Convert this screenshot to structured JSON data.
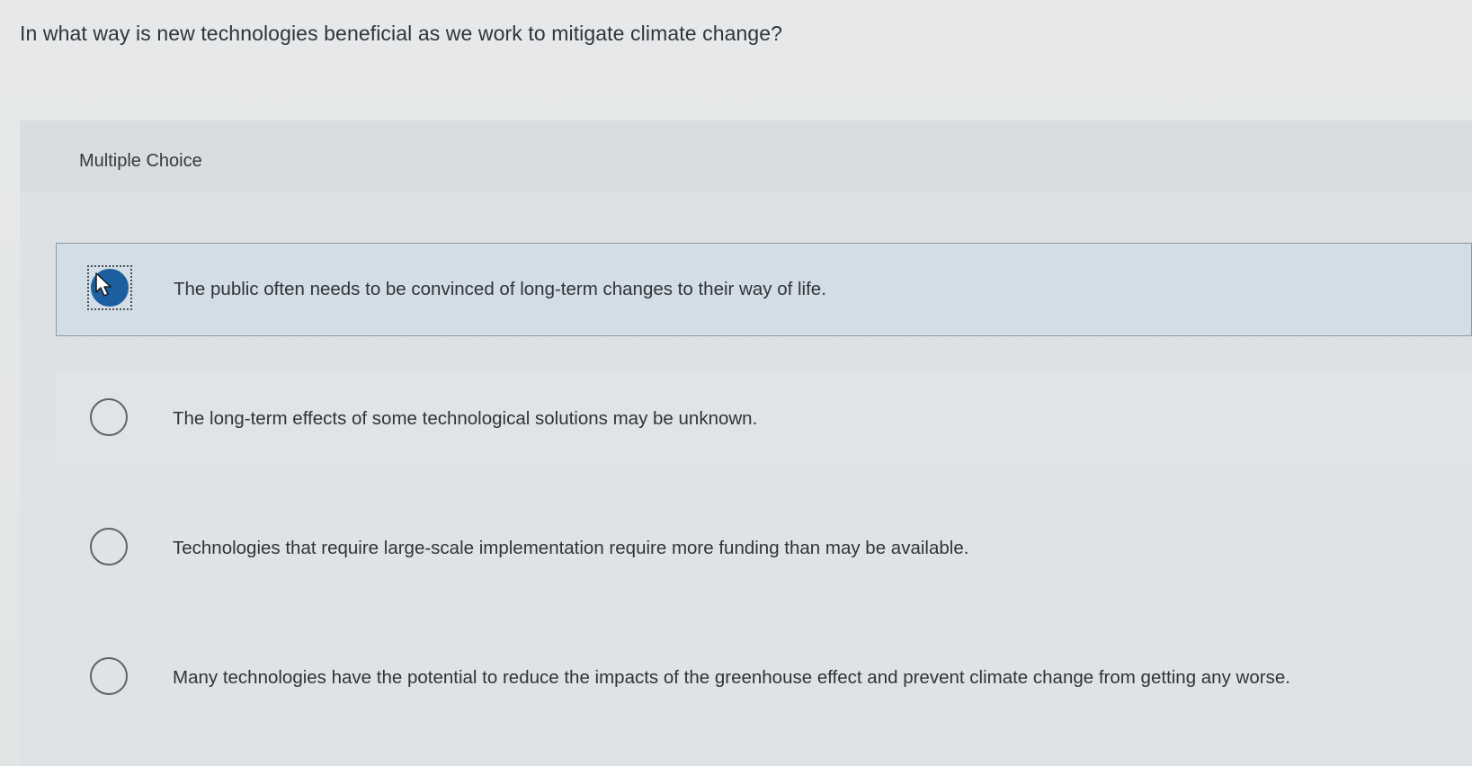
{
  "question": "In what way is new technologies beneficial as we work to mitigate climate change?",
  "panel": {
    "label": "Multiple Choice"
  },
  "options": [
    {
      "text": "The public often needs to be convinced of long-term changes to their way of life.",
      "selected": true
    },
    {
      "text": "The long-term effects of some technological solutions may be unknown.",
      "selected": false
    },
    {
      "text": "Technologies that require large-scale implementation require more funding than may be available.",
      "selected": false
    },
    {
      "text": "Many technologies have the potential to reduce the impacts of the greenhouse effect and prevent climate change from getting any worse.",
      "selected": false
    }
  ],
  "colors": {
    "selected_radio": "#1b5fa0",
    "selected_background": "#d3dde6"
  },
  "icons": {
    "cursor": "mouse-pointer-icon"
  }
}
